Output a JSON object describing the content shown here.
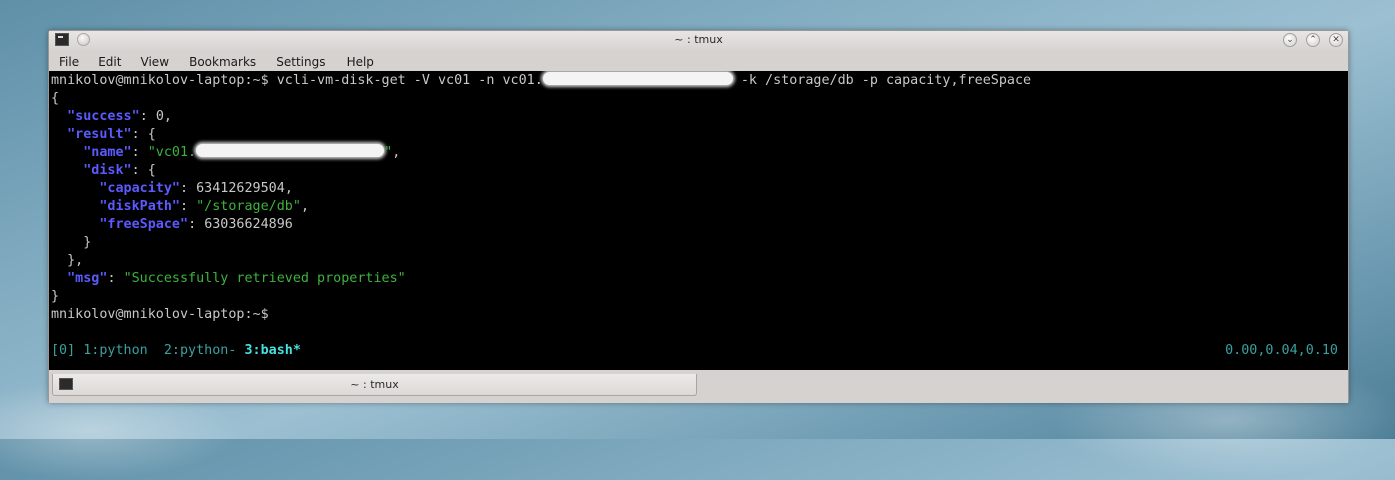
{
  "window": {
    "title": "~ : tmux",
    "buttons": {
      "minimize": "⌄",
      "maximize": "⌃",
      "close": "✕"
    }
  },
  "menu": [
    "File",
    "Edit",
    "View",
    "Bookmarks",
    "Settings",
    "Help"
  ],
  "terminal": {
    "prompt": "mnikolov@mnikolov-laptop:~$",
    "command_part1": " vcli-vm-disk-get -V vc01 -n vc01.",
    "command_part2": " -k /storage/db -p capacity,freeSpace",
    "json": {
      "open_brace": "{",
      "success_key": "\"success\"",
      "success_val": "0",
      "result_key": "\"result\"",
      "name_key": "\"name\"",
      "name_val_prefix": "\"vc01.",
      "name_val_suffix": "\"",
      "disk_key": "\"disk\"",
      "capacity_key": "\"capacity\"",
      "capacity_val": "63412629504",
      "diskpath_key": "\"diskPath\"",
      "diskpath_val": "\"/storage/db\"",
      "freespace_key": "\"freeSpace\"",
      "freespace_val": "63036624896",
      "msg_key": "\"msg\"",
      "msg_val": "\"Successfully retrieved properties\"",
      "close_brace": "}"
    },
    "prompt2": "mnikolov@mnikolov-laptop:~$"
  },
  "tmux_status": {
    "session": "[0]",
    "windows_inactive": "1:python  2:python-",
    "window_active": "3:bash*",
    "load": "0.00,0.04,0.10"
  },
  "tab": {
    "label": "~ : tmux",
    "icon": "terminal-icon"
  },
  "colors": {
    "json_key": "#5a5aff",
    "json_string": "#3cb33c",
    "tmux_status": "#3aa0a0",
    "tmux_active": "#46e0e0"
  }
}
